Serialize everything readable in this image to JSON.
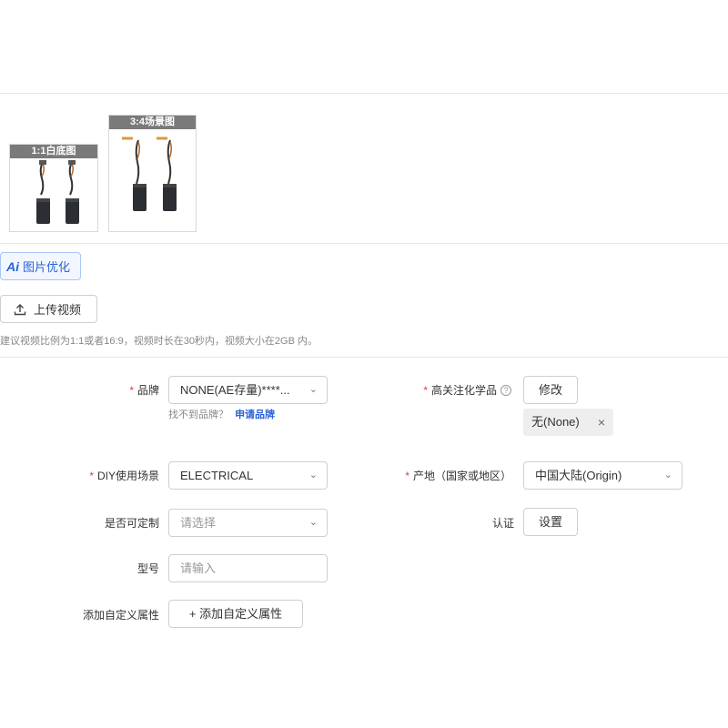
{
  "images": {
    "white_bg_tag": "1:1白底图",
    "scene_tag": "3:4场景图"
  },
  "ai_optimize": {
    "mark": "Ai",
    "label": "图片优化"
  },
  "video": {
    "upload_label": "上传视频",
    "hint": "建议视频比例为1:1或者16:9，视频时长在30秒内，视频大小在2GB 内。"
  },
  "form": {
    "brand": {
      "label": "品牌",
      "value": "NONE(AE存量)****...",
      "not_found": "找不到品牌？",
      "apply_link": "申请品牌"
    },
    "chemical": {
      "label": "高关注化学品",
      "help": "?",
      "button": "修改",
      "chip": "无(None)",
      "chip_remove": "×"
    },
    "diy_scene": {
      "label": "DIY使用场景",
      "value": "ELECTRICAL"
    },
    "origin": {
      "label": "产地（国家或地区）",
      "value": "中国大陆(Origin)"
    },
    "customizable": {
      "label": "是否可定制",
      "placeholder": "请选择"
    },
    "certification": {
      "label": "认证",
      "button": "设置"
    },
    "model": {
      "label": "型号",
      "placeholder": "请输入"
    },
    "custom_attr": {
      "label": "添加自定义属性",
      "button": "+ 添加自定义属性"
    }
  },
  "required_mark": "*",
  "colors": {
    "accent": "#2a63d8",
    "required": "#e03c3c",
    "tag_bg": "#7a7a7a"
  }
}
